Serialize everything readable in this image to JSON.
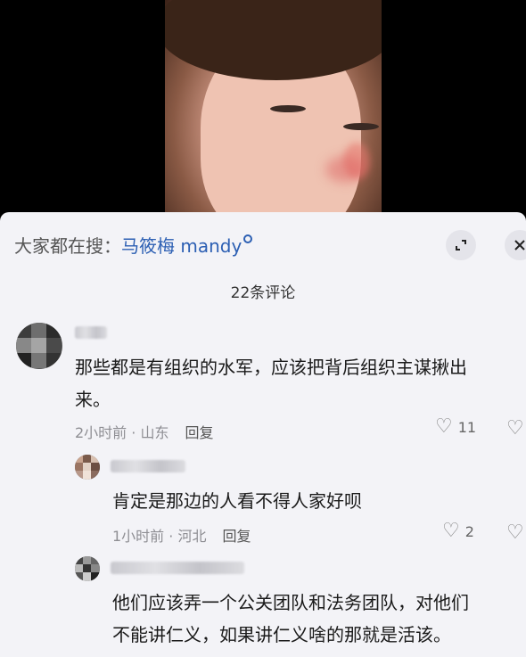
{
  "search": {
    "prefix": "大家都在搜：",
    "term": "马筱梅 mandy"
  },
  "comments_count": "22条评论",
  "comments": [
    {
      "text_line1": "那些都是有组织的水军，应该把背后组织主谋揪出",
      "text_line2": "来。",
      "time_location": "2小时前 · 山东",
      "reply_label": "回复",
      "likes": "11"
    },
    {
      "text_line1": "肯定是那边的人看不得人家好呗",
      "time_location": "1小时前 · 河北",
      "reply_label": "回复",
      "likes": "2"
    },
    {
      "text_line1": "他们应该弄一个公关团队和法务团队，对他们",
      "text_line2": "不能讲仁义，如果讲仁义啥的那就是活该。"
    }
  ],
  "icons": {
    "expand": "expand-icon",
    "close": "close-icon",
    "like": "heart-icon",
    "dislike": "broken-heart-icon"
  }
}
